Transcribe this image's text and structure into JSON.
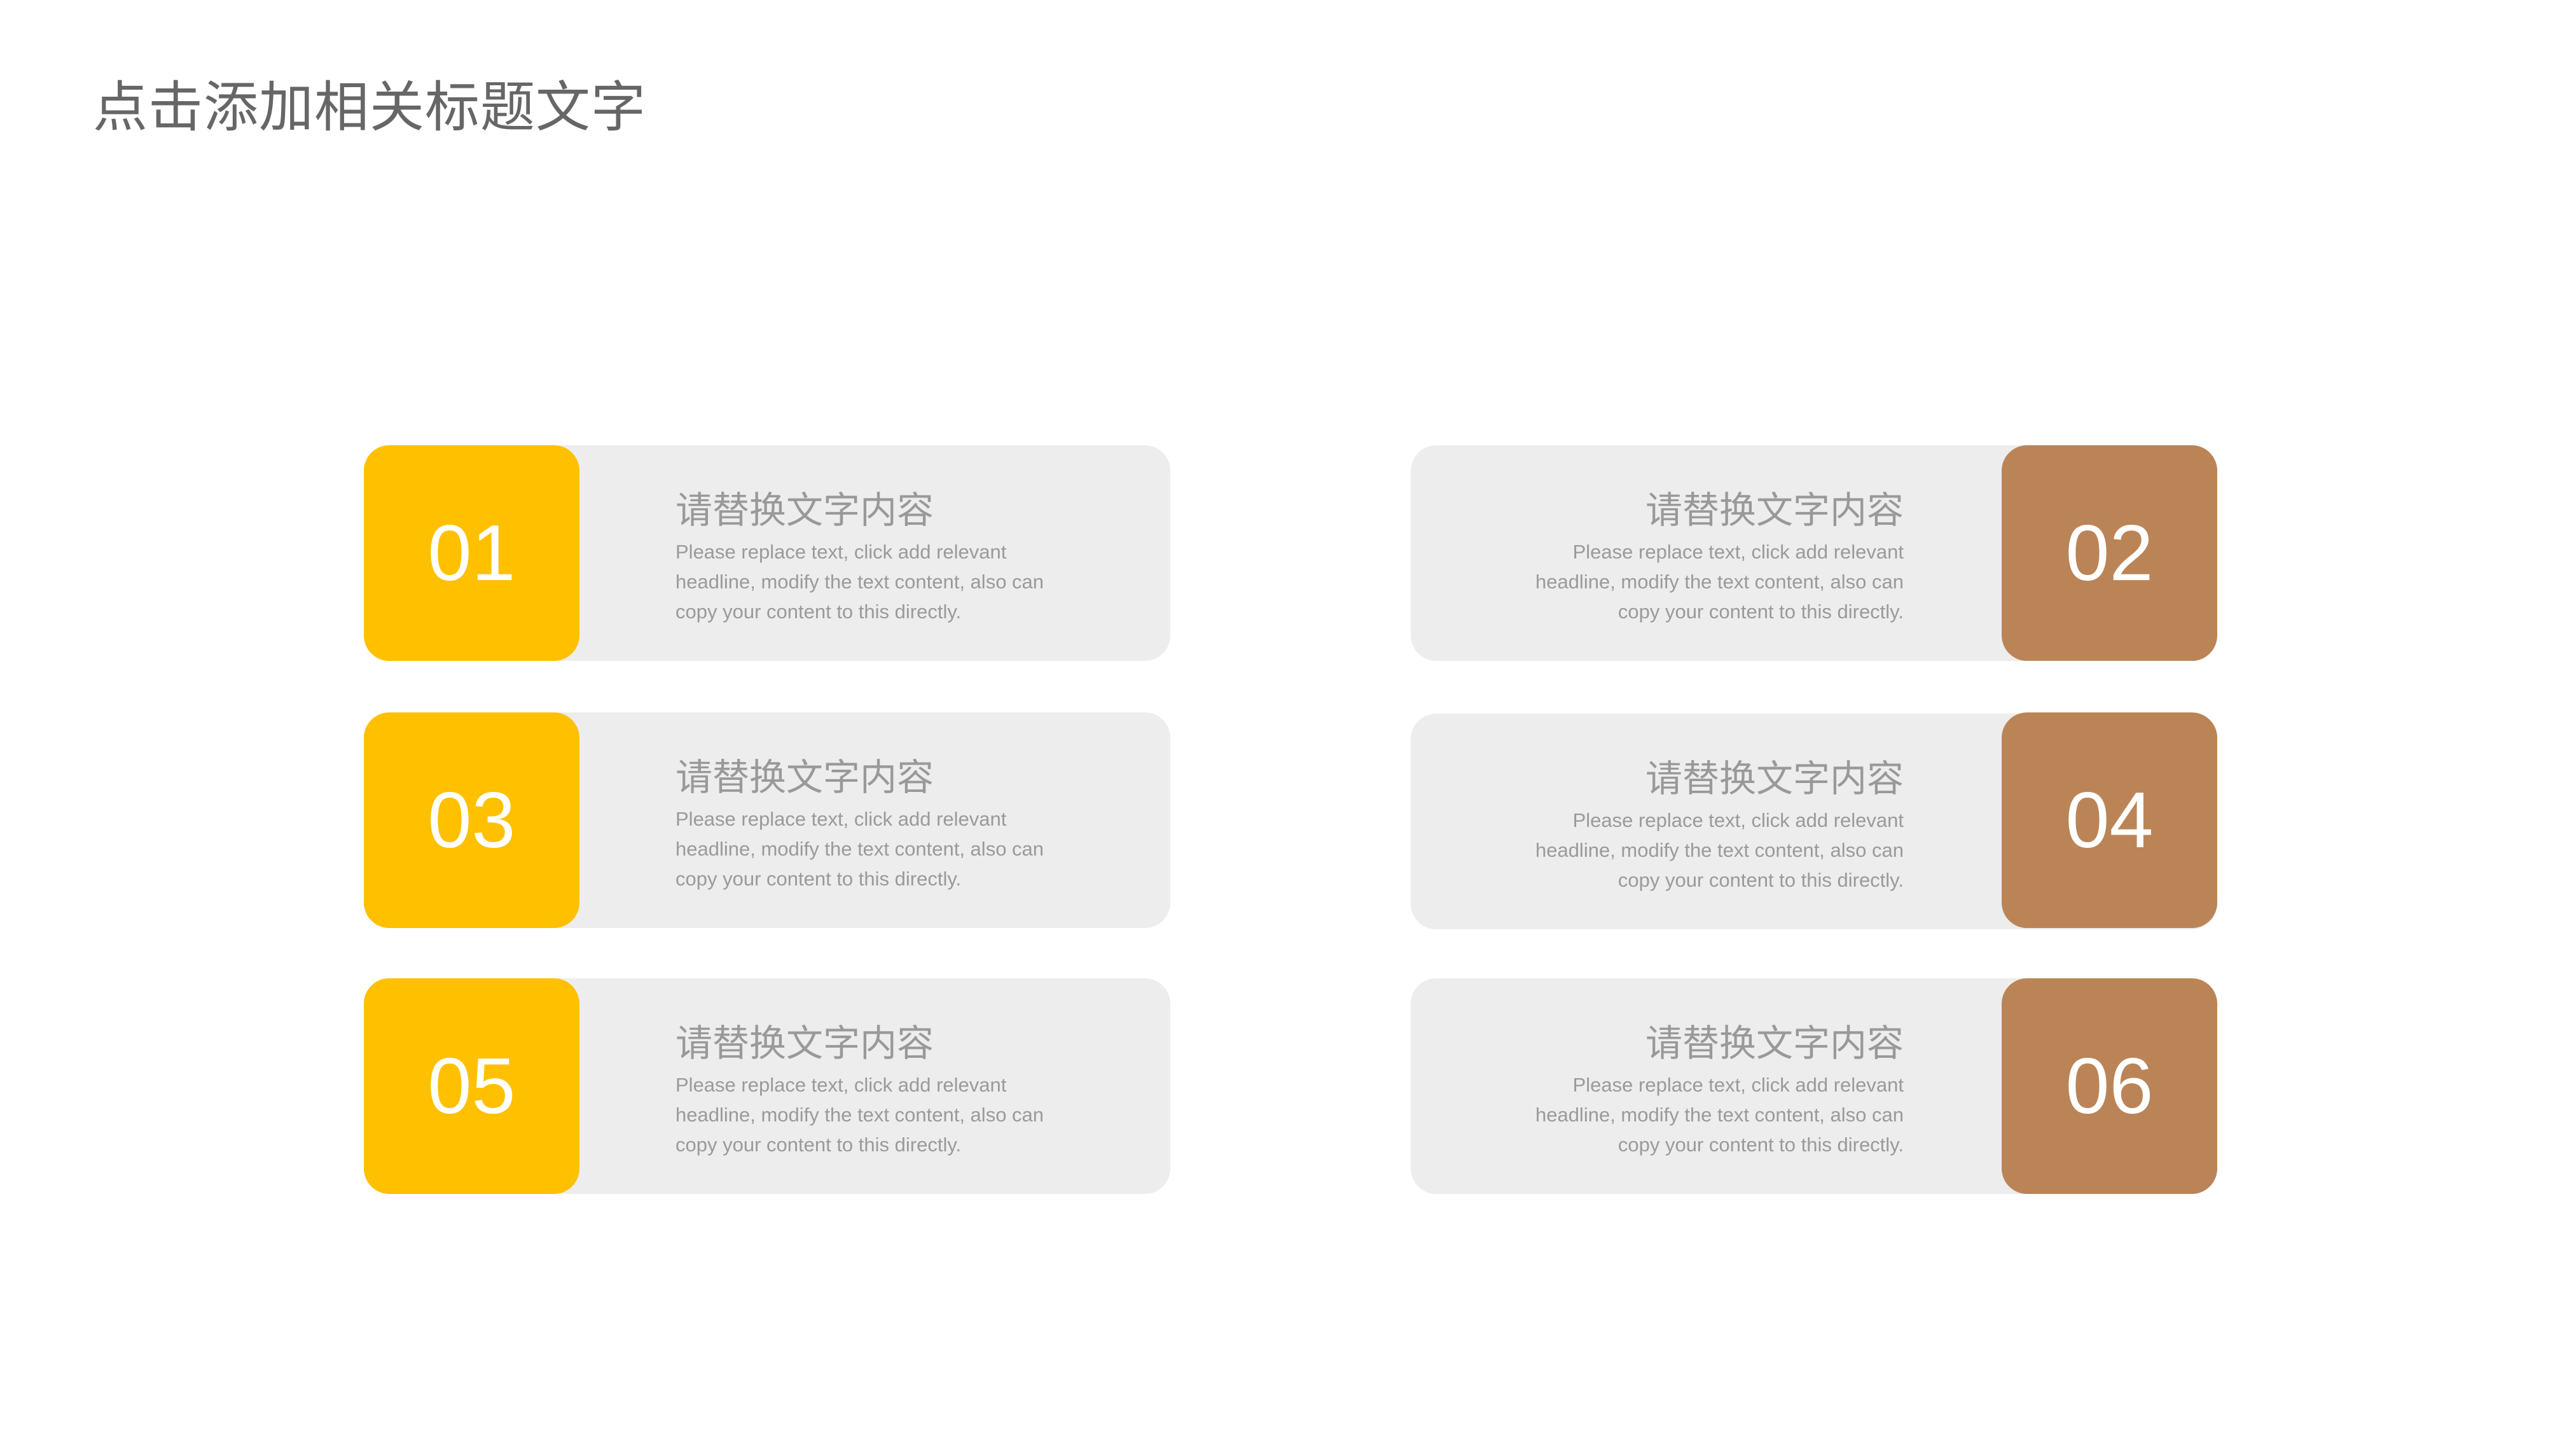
{
  "title": "点击添加相关标题文字",
  "colors": {
    "left_accent": "#ffc000",
    "right_accent": "#bb8457",
    "card_bg": "#ededed",
    "text_gray": "#999999"
  },
  "items": [
    {
      "number": "01",
      "heading": "请替换文字内容",
      "body": [
        "Please replace text, click add relevant",
        "headline, modify the text content, also can",
        "copy your content to this directly."
      ]
    },
    {
      "number": "02",
      "heading": "请替换文字内容",
      "body": [
        "Please replace text, click add relevant",
        "headline, modify the text content, also can",
        "copy your content to this directly."
      ]
    },
    {
      "number": "03",
      "heading": "请替换文字内容",
      "body": [
        "Please replace text, click add relevant",
        "headline, modify the text content, also can",
        "copy your content to this directly."
      ]
    },
    {
      "number": "04",
      "heading": "请替换文字内容",
      "body": [
        "Please replace text, click add relevant",
        "headline, modify the text content, also can",
        "copy your content to this directly."
      ]
    },
    {
      "number": "05",
      "heading": "请替换文字内容",
      "body": [
        "Please replace text, click add relevant",
        "headline, modify the text content, also can",
        "copy your content to this directly."
      ]
    },
    {
      "number": "06",
      "heading": "请替换文字内容",
      "body": [
        "Please replace text, click add relevant",
        "headline, modify the text content, also can",
        "copy your content to this directly."
      ]
    }
  ]
}
